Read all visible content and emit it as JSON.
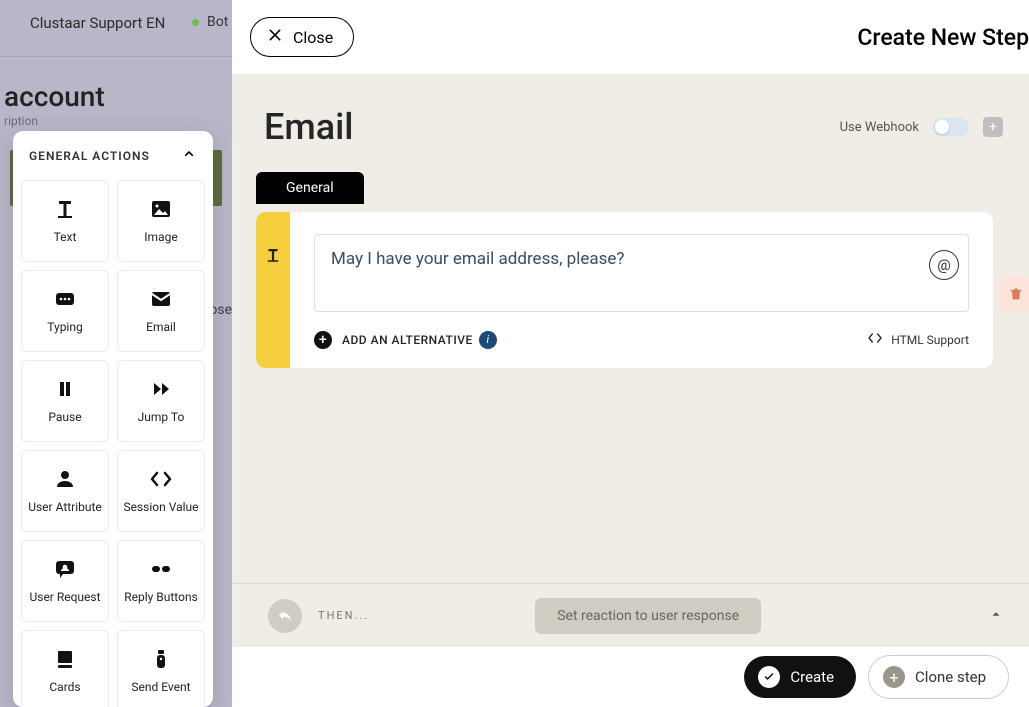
{
  "bg": {
    "app_name": "Clustaar Support EN",
    "bot_status": "Bot",
    "page_heading": "account",
    "page_sub": "ription",
    "side_text": "lose"
  },
  "actions_panel": {
    "title": "GENERAL ACTIONS",
    "items": [
      {
        "label": "Text",
        "icon": "text-icon"
      },
      {
        "label": "Image",
        "icon": "image-icon"
      },
      {
        "label": "Typing",
        "icon": "typing-icon"
      },
      {
        "label": "Email",
        "icon": "email-icon"
      },
      {
        "label": "Pause",
        "icon": "pause-icon"
      },
      {
        "label": "Jump To",
        "icon": "jump-icon"
      },
      {
        "label": "User Attribute",
        "icon": "user-attr-icon"
      },
      {
        "label": "Session Value",
        "icon": "session-icon"
      },
      {
        "label": "User Request",
        "icon": "user-req-icon"
      },
      {
        "label": "Reply Buttons",
        "icon": "reply-icon"
      },
      {
        "label": "Cards",
        "icon": "cards-icon"
      },
      {
        "label": "Send Event",
        "icon": "send-event-icon"
      }
    ]
  },
  "panel": {
    "close_label": "Close",
    "header_title": "Create New Step",
    "body_title": "Email",
    "webhook_label": "Use Webhook",
    "tab_general": "General",
    "text_value": "May I have your email address, please?",
    "at_symbol": "@",
    "add_alt_label": "ADD AN ALTERNATIVE",
    "html_support_label": "HTML Support",
    "then_label": "THEN...",
    "reaction_pill": "Set reaction to user response",
    "create_label": "Create",
    "clone_label": "Clone step"
  }
}
